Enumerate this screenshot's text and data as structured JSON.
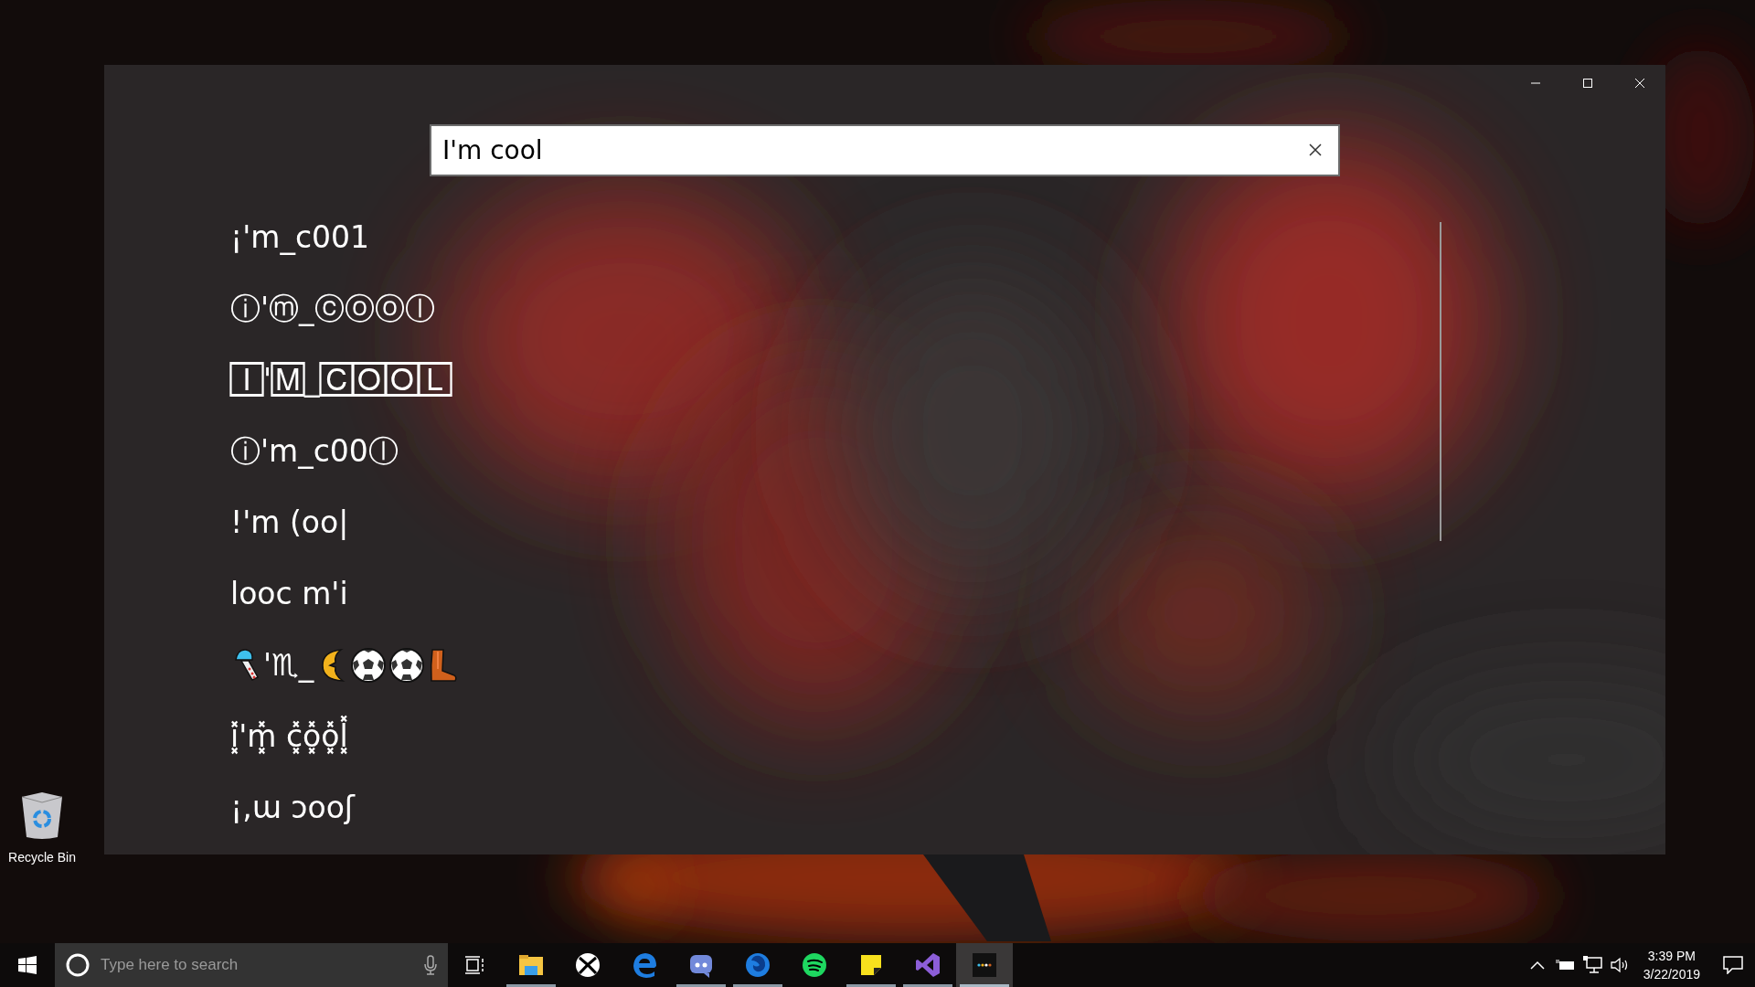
{
  "search": {
    "value": "I'm cool"
  },
  "results": [
    {
      "kind": "text",
      "text": "¡'m_c001"
    },
    {
      "kind": "text",
      "text": "ⓘ'ⓜ_ⓒⓞⓞⓛ"
    },
    {
      "kind": "text",
      "text": "🄸'🄼_🄲🄾🄾🄻"
    },
    {
      "kind": "text",
      "text": "ⓘ'm_c00ⓛ"
    },
    {
      "kind": "text",
      "text": "!'m (oo|"
    },
    {
      "kind": "text",
      "text": "looc m'i"
    },
    {
      "kind": "parts",
      "parts": [
        {
          "kind": "chime"
        },
        {
          "kind": "text",
          "text": "'♏_"
        },
        {
          "kind": "moon"
        },
        {
          "kind": "ball"
        },
        {
          "kind": "ball"
        },
        {
          "kind": "boot"
        }
      ]
    },
    {
      "kind": "text",
      "text": "i͓̽'m͓̽ c͓̽o͓̽o͓̽l͓̽"
    },
    {
      "kind": "text",
      "text": "¡,ɯ ɔooʃ"
    }
  ],
  "desktop_icons": [
    {
      "label": "Recycle Bin"
    }
  ],
  "taskbar": {
    "search_placeholder": "Type here to search",
    "apps": [
      {
        "kind": "explorer",
        "running": true,
        "selected": false
      },
      {
        "kind": "xbox",
        "running": false,
        "selected": false
      },
      {
        "kind": "edge",
        "running": false,
        "selected": false
      },
      {
        "kind": "discord",
        "running": true,
        "selected": false
      },
      {
        "kind": "firefox",
        "running": true,
        "selected": false
      },
      {
        "kind": "spotify",
        "running": false,
        "selected": false
      },
      {
        "kind": "sticky",
        "running": true,
        "selected": false
      },
      {
        "kind": "vs",
        "running": true,
        "selected": false
      },
      {
        "kind": "app",
        "running": true,
        "selected": true
      }
    ],
    "clock": {
      "time": "3:39 PM",
      "date": "3/22/2019"
    }
  }
}
